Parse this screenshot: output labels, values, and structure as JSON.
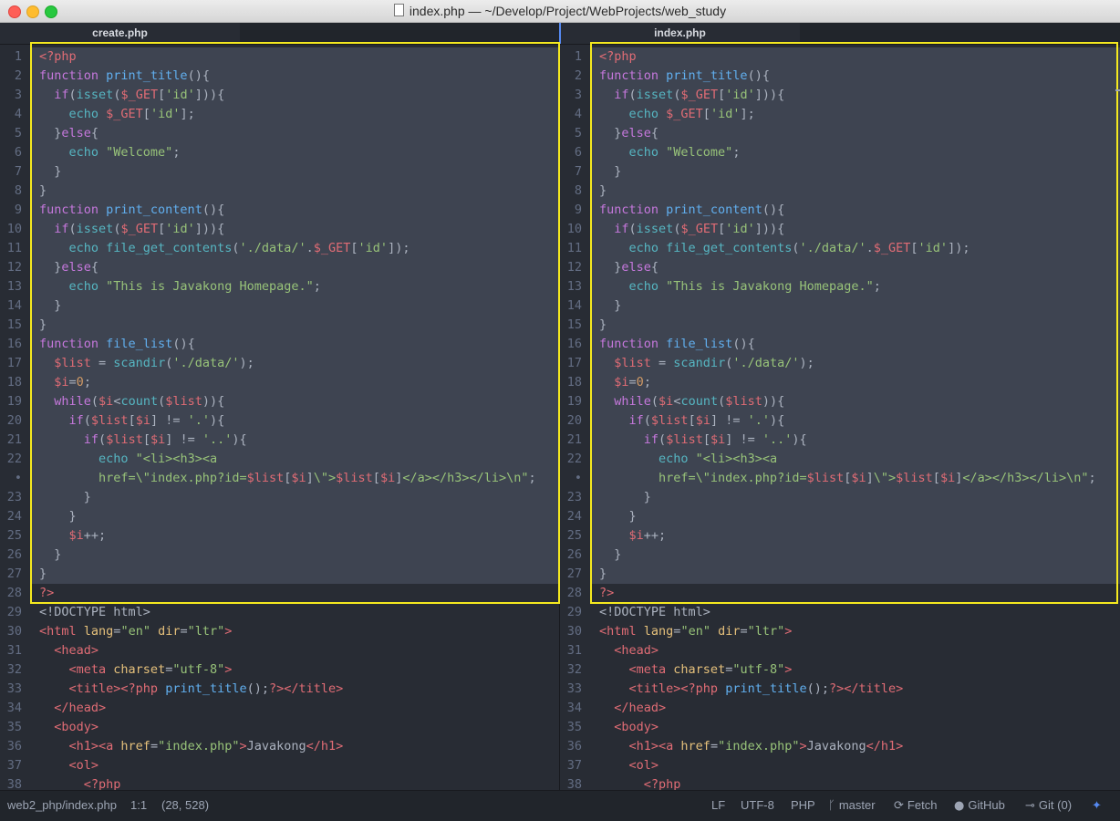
{
  "window": {
    "title": "index.php — ~/Develop/Project/WebProjects/web_study"
  },
  "left_pane": {
    "tab": "create.php"
  },
  "right_pane": {
    "tab": "index.php"
  },
  "code": {
    "line_numbers": [
      "1",
      "2",
      "3",
      "4",
      "5",
      "6",
      "7",
      "8",
      "9",
      "10",
      "11",
      "12",
      "13",
      "14",
      "15",
      "16",
      "17",
      "18",
      "19",
      "20",
      "21",
      "22",
      "•",
      "23",
      "24",
      "25",
      "26",
      "27",
      "28",
      "29",
      "30",
      "31",
      "32",
      "33",
      "34",
      "35",
      "36",
      "37",
      "38"
    ],
    "selected_rows": 28,
    "lines": [
      [
        [
          "v",
          "<?php"
        ]
      ],
      [
        [
          "k",
          "function "
        ],
        [
          "f",
          "print_title"
        ],
        [
          "p",
          "(){"
        ]
      ],
      [
        [
          "p",
          "  "
        ],
        [
          "k",
          "if"
        ],
        [
          "p",
          "("
        ],
        [
          "b",
          "isset"
        ],
        [
          "p",
          "("
        ],
        [
          "v",
          "$_GET"
        ],
        [
          "p",
          "["
        ],
        [
          "s",
          "'id'"
        ],
        [
          "p",
          "])){"
        ]
      ],
      [
        [
          "p",
          "    "
        ],
        [
          "b",
          "echo "
        ],
        [
          "v",
          "$_GET"
        ],
        [
          "p",
          "["
        ],
        [
          "s",
          "'id'"
        ],
        [
          "p",
          "];"
        ]
      ],
      [
        [
          "p",
          "  }"
        ],
        [
          "k",
          "else"
        ],
        [
          "p",
          "{"
        ]
      ],
      [
        [
          "p",
          "    "
        ],
        [
          "b",
          "echo "
        ],
        [
          "s",
          "\"Welcome\""
        ],
        [
          "p",
          ";"
        ]
      ],
      [
        [
          "p",
          "  }"
        ]
      ],
      [
        [
          "p",
          "}"
        ]
      ],
      [
        [
          "k",
          "function "
        ],
        [
          "f",
          "print_content"
        ],
        [
          "p",
          "(){"
        ]
      ],
      [
        [
          "p",
          "  "
        ],
        [
          "k",
          "if"
        ],
        [
          "p",
          "("
        ],
        [
          "b",
          "isset"
        ],
        [
          "p",
          "("
        ],
        [
          "v",
          "$_GET"
        ],
        [
          "p",
          "["
        ],
        [
          "s",
          "'id'"
        ],
        [
          "p",
          "])){"
        ]
      ],
      [
        [
          "p",
          "    "
        ],
        [
          "b",
          "echo "
        ],
        [
          "b",
          "file_get_contents"
        ],
        [
          "p",
          "("
        ],
        [
          "s",
          "'./data/'"
        ],
        [
          "p",
          "."
        ],
        [
          "v",
          "$_GET"
        ],
        [
          "p",
          "["
        ],
        [
          "s",
          "'id'"
        ],
        [
          "p",
          "]);"
        ]
      ],
      [
        [
          "p",
          "  }"
        ],
        [
          "k",
          "else"
        ],
        [
          "p",
          "{"
        ]
      ],
      [
        [
          "p",
          "    "
        ],
        [
          "b",
          "echo "
        ],
        [
          "s",
          "\"This is Javakong Homepage.\""
        ],
        [
          "p",
          ";"
        ]
      ],
      [
        [
          "p",
          "  }"
        ]
      ],
      [
        [
          "p",
          "}"
        ]
      ],
      [
        [
          "k",
          "function "
        ],
        [
          "f",
          "file_list"
        ],
        [
          "p",
          "(){"
        ]
      ],
      [
        [
          "p",
          "  "
        ],
        [
          "v",
          "$list"
        ],
        [
          "p",
          " = "
        ],
        [
          "b",
          "scandir"
        ],
        [
          "p",
          "("
        ],
        [
          "s",
          "'./data/'"
        ],
        [
          "p",
          ");"
        ]
      ],
      [
        [
          "p",
          "  "
        ],
        [
          "v",
          "$i"
        ],
        [
          "p",
          "="
        ],
        [
          "n",
          "0"
        ],
        [
          "p",
          ";"
        ]
      ],
      [
        [
          "p",
          "  "
        ],
        [
          "k",
          "while"
        ],
        [
          "p",
          "("
        ],
        [
          "v",
          "$i"
        ],
        [
          "p",
          "<"
        ],
        [
          "b",
          "count"
        ],
        [
          "p",
          "("
        ],
        [
          "v",
          "$list"
        ],
        [
          "p",
          "))"
        ],
        [
          "p",
          "{"
        ]
      ],
      [
        [
          "p",
          "    "
        ],
        [
          "k",
          "if"
        ],
        [
          "p",
          "("
        ],
        [
          "v",
          "$list"
        ],
        [
          "p",
          "["
        ],
        [
          "v",
          "$i"
        ],
        [
          "p",
          "] != "
        ],
        [
          "s",
          "'.'"
        ],
        [
          "p",
          "){"
        ]
      ],
      [
        [
          "p",
          "      "
        ],
        [
          "k",
          "if"
        ],
        [
          "p",
          "("
        ],
        [
          "v",
          "$list"
        ],
        [
          "p",
          "["
        ],
        [
          "v",
          "$i"
        ],
        [
          "p",
          "] != "
        ],
        [
          "s",
          "'..'"
        ],
        [
          "p",
          "){"
        ]
      ],
      [
        [
          "p",
          "        "
        ],
        [
          "b",
          "echo "
        ],
        [
          "s",
          "\"<li><h3><a"
        ]
      ],
      [
        [
          "s",
          "        href=\\\"index.php?id="
        ],
        [
          "v",
          "$list"
        ],
        [
          "p",
          "["
        ],
        [
          "v",
          "$i"
        ],
        [
          "p",
          "]"
        ],
        [
          "s",
          "\\\">"
        ],
        [
          "v",
          "$list"
        ],
        [
          "p",
          "["
        ],
        [
          "v",
          "$i"
        ],
        [
          "p",
          "]"
        ],
        [
          "s",
          "</a></h3></li>\\n\""
        ],
        [
          "p",
          ";"
        ]
      ],
      [
        [
          "p",
          "      }"
        ]
      ],
      [
        [
          "p",
          "    }"
        ]
      ],
      [
        [
          "p",
          "    "
        ],
        [
          "v",
          "$i"
        ],
        [
          "p",
          "++;"
        ]
      ],
      [
        [
          "p",
          "  }"
        ]
      ],
      [
        [
          "p",
          "}"
        ]
      ],
      [
        [
          "v",
          "?>"
        ]
      ],
      [
        [
          "p",
          "<!DOCTYPE html>"
        ]
      ],
      [
        [
          "t",
          "<html "
        ],
        [
          "d",
          "lang"
        ],
        [
          "p",
          "="
        ],
        [
          "s",
          "\"en\" "
        ],
        [
          "d",
          "dir"
        ],
        [
          "p",
          "="
        ],
        [
          "s",
          "\"ltr\""
        ],
        [
          "t",
          ">"
        ]
      ],
      [
        [
          "p",
          "  "
        ],
        [
          "t",
          "<head>"
        ]
      ],
      [
        [
          "p",
          "    "
        ],
        [
          "t",
          "<meta "
        ],
        [
          "d",
          "charset"
        ],
        [
          "p",
          "="
        ],
        [
          "s",
          "\"utf-8\""
        ],
        [
          "t",
          ">"
        ]
      ],
      [
        [
          "p",
          "    "
        ],
        [
          "t",
          "<title>"
        ],
        [
          "v",
          "<?php "
        ],
        [
          "f",
          "print_title"
        ],
        [
          "p",
          "();"
        ],
        [
          "v",
          "?>"
        ],
        [
          "t",
          "</title>"
        ]
      ],
      [
        [
          "p",
          "  "
        ],
        [
          "t",
          "</head>"
        ]
      ],
      [
        [
          "p",
          "  "
        ],
        [
          "t",
          "<body>"
        ]
      ],
      [
        [
          "p",
          "    "
        ],
        [
          "t",
          "<h1><a "
        ],
        [
          "d",
          "href"
        ],
        [
          "p",
          "="
        ],
        [
          "s",
          "\"index.php\""
        ],
        [
          "t",
          ">"
        ],
        [
          "p",
          "Javakong"
        ],
        [
          "t",
          "</h1>"
        ]
      ],
      [
        [
          "p",
          "    "
        ],
        [
          "t",
          "<ol>"
        ]
      ],
      [
        [
          "p",
          "      "
        ],
        [
          "v",
          "<?php"
        ]
      ]
    ]
  },
  "status": {
    "file": "web2_php/index.php",
    "cursor": "1:1",
    "selection": "(28, 528)",
    "line_ending": "LF",
    "encoding": "UTF-8",
    "grammar": "PHP",
    "branch": "master",
    "fetch": "Fetch",
    "github": "GitHub",
    "git": "Git (0)"
  }
}
